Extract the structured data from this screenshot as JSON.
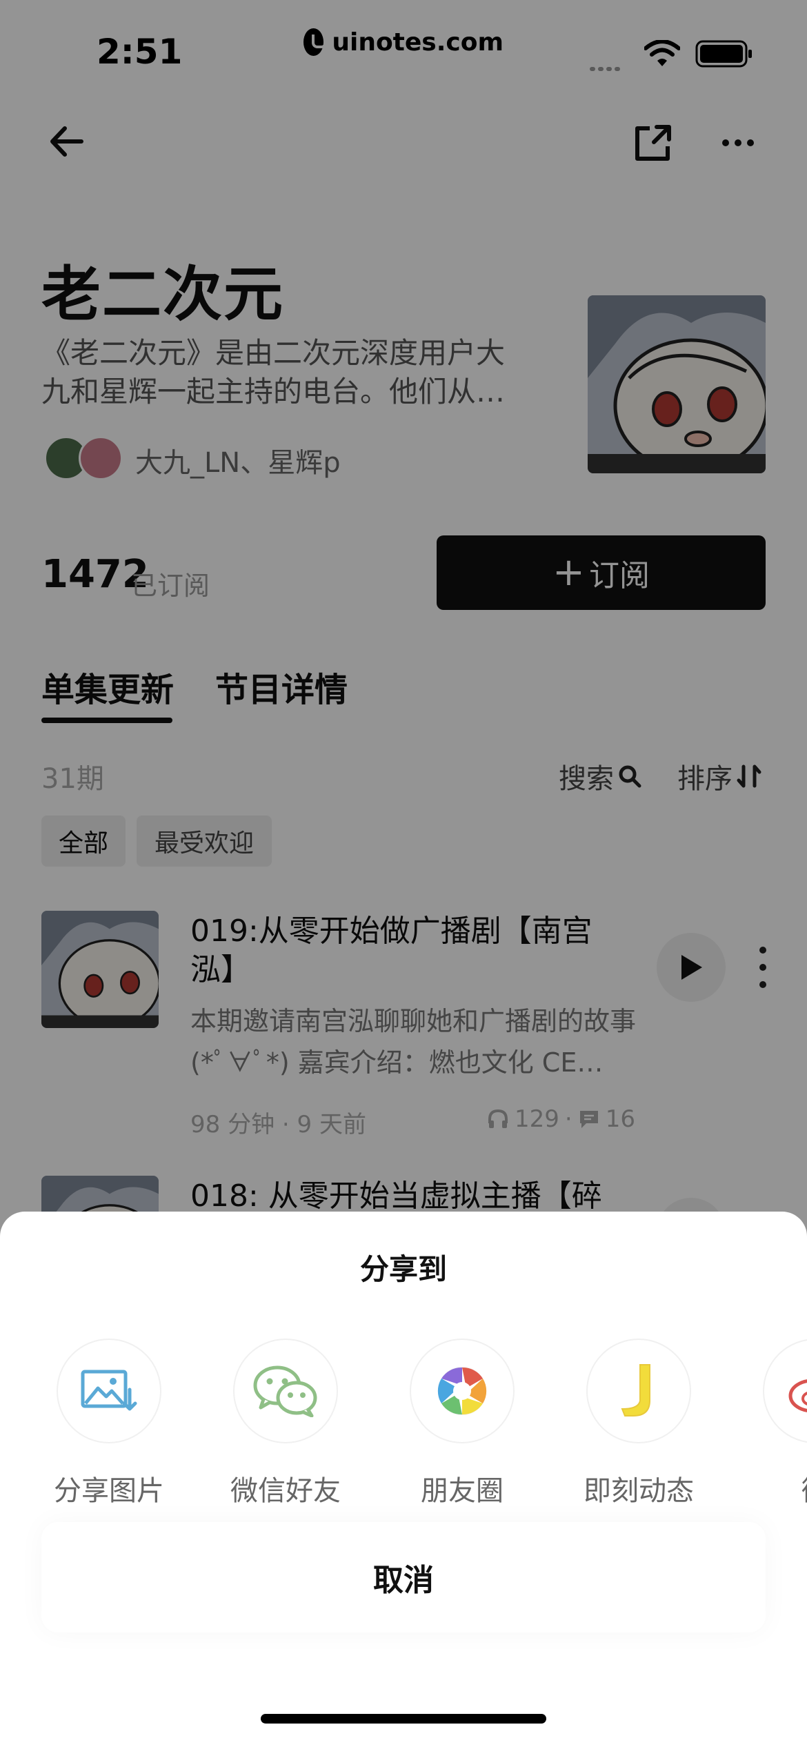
{
  "status_bar": {
    "time": "2:51",
    "site": "uinotes.com"
  },
  "podcast": {
    "title": "老二次元",
    "description": "《老二次元》是由二次元深度用户大九和星辉一起主持的电台。他们从…",
    "hosts": "大九_LN、星辉p",
    "subscriber_count": "1472",
    "subscriber_label": "已订阅",
    "subscribe_label": "订阅"
  },
  "tabs": [
    {
      "label": "单集更新",
      "active": true
    },
    {
      "label": "节目详情",
      "active": false
    }
  ],
  "episode_list": {
    "count": "31期",
    "search_label": "搜索",
    "sort_label": "排序",
    "filters": [
      "全部",
      "最受欢迎"
    ],
    "episodes": [
      {
        "title": "019:从零开始做广播剧【南宫泓】",
        "description": "本期邀请南宫泓聊聊她和广播剧的故事 (*ﾟ∀ﾟ*) 嘉宾介绍：燃也文化 CE…",
        "duration": "98 分钟",
        "published": "9 天前",
        "plays": "129",
        "comments": "16"
      },
      {
        "title": "018: 从零开始当虚拟主播【碎"
      }
    ]
  },
  "share_sheet": {
    "title": "分享到",
    "options": [
      {
        "label": "分享图片",
        "icon": "image-share-icon",
        "color": "#5aa9d6"
      },
      {
        "label": "微信好友",
        "icon": "wechat-icon",
        "color": "#8fbf86"
      },
      {
        "label": "朋友圈",
        "icon": "moments-icon",
        "color": "#e05a4a"
      },
      {
        "label": "即刻动态",
        "icon": "jike-icon",
        "color": "#f2dc3b"
      },
      {
        "label": "微",
        "icon": "weibo-icon",
        "color": "#d9534f"
      }
    ],
    "cancel_label": "取消"
  }
}
